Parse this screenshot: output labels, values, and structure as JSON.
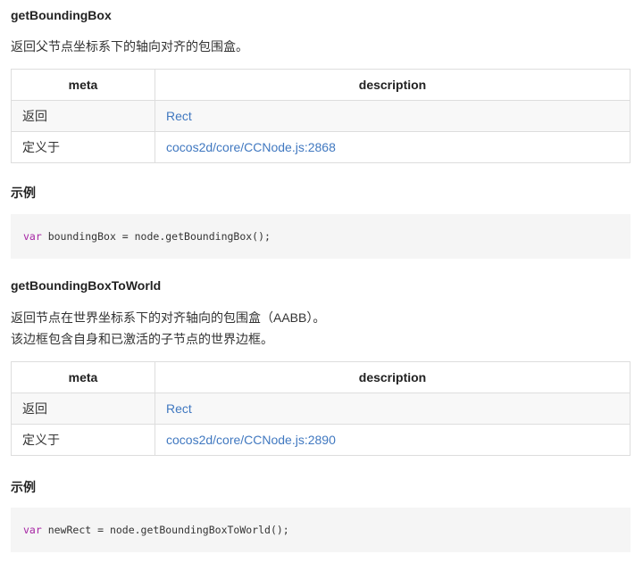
{
  "sections": [
    {
      "title": "getBoundingBox",
      "description_lines": [
        "返回父节点坐标系下的轴向对齐的包围盒。"
      ],
      "table": {
        "headers": [
          "meta",
          "description"
        ],
        "rows": [
          {
            "label": "返回",
            "value": "Rect"
          },
          {
            "label": "定义于",
            "value": "cocos2d/core/CCNode.js:2868"
          }
        ]
      },
      "example_title": "示例",
      "code": {
        "keyword": "var",
        "rest": " boundingBox = node.getBoundingBox();"
      }
    },
    {
      "title": "getBoundingBoxToWorld",
      "description_lines": [
        "返回节点在世界坐标系下的对齐轴向的包围盒（AABB）。",
        "该边框包含自身和已激活的子节点的世界边框。"
      ],
      "table": {
        "headers": [
          "meta",
          "description"
        ],
        "rows": [
          {
            "label": "返回",
            "value": "Rect"
          },
          {
            "label": "定义于",
            "value": "cocos2d/core/CCNode.js:2890"
          }
        ]
      },
      "example_title": "示例",
      "code": {
        "keyword": "var",
        "rest": " newRect = node.getBoundingBoxToWorld();"
      }
    }
  ],
  "colors": {
    "link": "#4078c0",
    "code_bg": "#f5f5f5",
    "keyword": "#a626a4",
    "border": "#dddddd"
  }
}
